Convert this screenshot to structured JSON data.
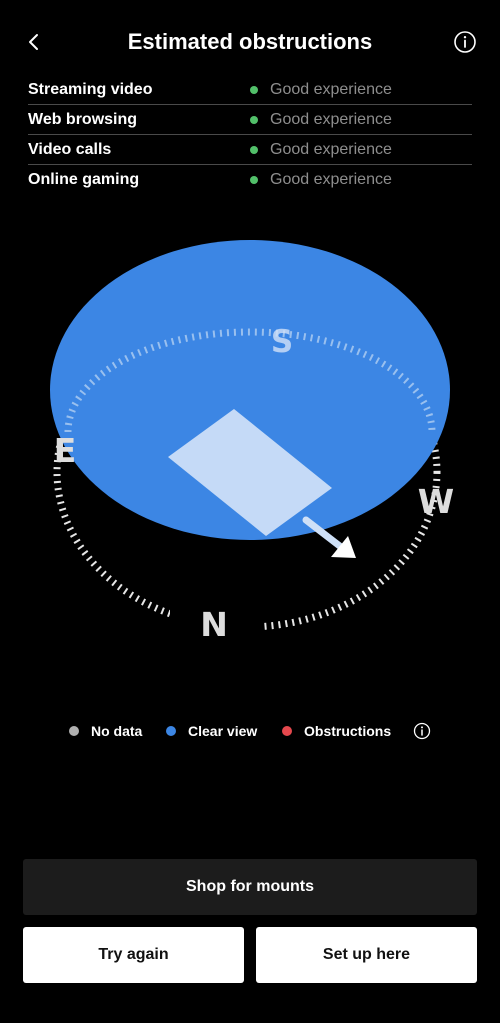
{
  "header": {
    "title": "Estimated obstructions"
  },
  "experience": [
    {
      "label": "Streaming video",
      "status": "Good experience"
    },
    {
      "label": "Web browsing",
      "status": "Good experience"
    },
    {
      "label": "Video calls",
      "status": "Good experience"
    },
    {
      "label": "Online gaming",
      "status": "Good experience"
    }
  ],
  "compass": {
    "north": "N",
    "south": "S",
    "east": "E",
    "west": "W"
  },
  "legend": {
    "no_data": "No data",
    "clear_view": "Clear view",
    "obstructions": "Obstructions"
  },
  "buttons": {
    "shop": "Shop for mounts",
    "try_again": "Try again",
    "set_up": "Set up here"
  },
  "colors": {
    "good_status": "#52c06a",
    "no_data": "#b0b0b0",
    "clear_view": "#3c86e4",
    "obstructions": "#e5484d",
    "background": "#000000"
  },
  "icons": {
    "back": "chevron-left-icon",
    "info": "info-icon",
    "direction": "arrow-icon"
  }
}
